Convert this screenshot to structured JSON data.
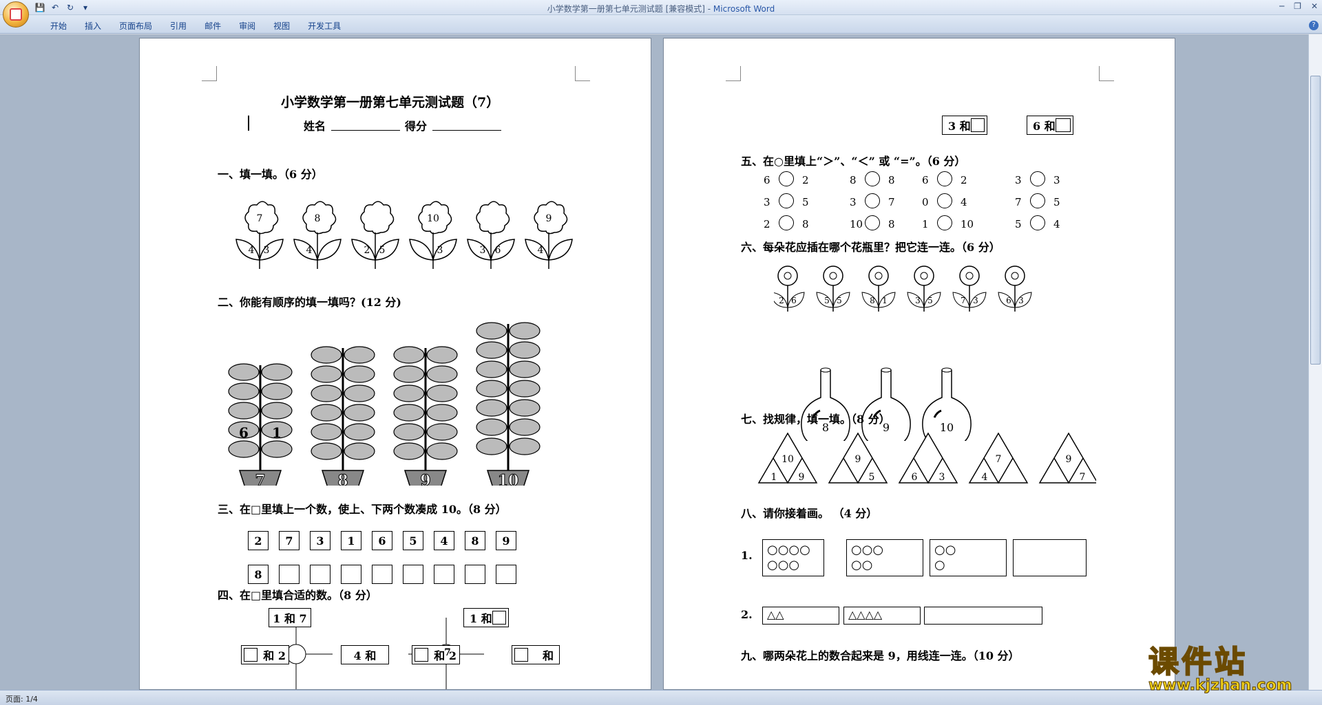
{
  "window": {
    "title": "小学数学第一册第七单元测试题 [兼容模式] - ",
    "app_name": "Microsoft Word"
  },
  "ribbon": {
    "tabs": [
      "开始",
      "插入",
      "页面布局",
      "引用",
      "邮件",
      "审阅",
      "视图",
      "开发工具"
    ]
  },
  "status": {
    "page": "页面: 1/4"
  },
  "watermark": {
    "text": "课件站",
    "url": "www.kjzhan.com"
  },
  "colors": {
    "watermark": "#f2d21a",
    "app_name": "#2a58a8"
  },
  "page1": {
    "title": "小学数学第一册第七单元测试题（7）",
    "name_label": "姓名",
    "score_label": "得分",
    "q1": "一、填一填。（6 分）",
    "flowers": [
      {
        "top": "7",
        "left": "4",
        "right": "3"
      },
      {
        "top": "8",
        "left": "4",
        "right": ""
      },
      {
        "top": "",
        "left": "2",
        "right": "5"
      },
      {
        "top": "10",
        "left": "",
        "right": "3"
      },
      {
        "top": "",
        "left": "3",
        "right": "6"
      },
      {
        "top": "9",
        "left": "4",
        "right": ""
      }
    ],
    "q2": "二、你能有顺序的填一填吗？(12 分)",
    "plants": [
      {
        "pot": "7",
        "left": "6",
        "right": "1"
      },
      {
        "pot": "8",
        "left": "",
        "right": ""
      },
      {
        "pot": "9",
        "left": "",
        "right": ""
      },
      {
        "pot": "10",
        "left": "",
        "right": ""
      }
    ],
    "q3": "三、在□里填上一个数，使上、下两个数凑成 10。（8 分）",
    "top_numbers": [
      "2",
      "7",
      "3",
      "1",
      "6",
      "5",
      "4",
      "8",
      "9"
    ],
    "bottom_numbers": [
      "8",
      "",
      "",
      "",
      "",
      "",
      "",
      "",
      ""
    ],
    "q4": "四、在□里填合适的数。（8 分）",
    "tree1": {
      "top": "1 和 7",
      "left": "和 2",
      "right": "4 和"
    },
    "tree2": {
      "top": "1 和",
      "left": "和 2",
      "center": "7",
      "right": "和"
    }
  },
  "page2": {
    "box_a": "3 和",
    "box_b": "6 和",
    "q5": "五、在○里填上“＞”、“＜” 或 “=”。（6 分）",
    "compare_rows": [
      [
        [
          "6",
          "2"
        ],
        [
          "8",
          "8"
        ],
        [
          "6",
          "2"
        ],
        [
          "3",
          "3"
        ]
      ],
      [
        [
          "3",
          "5"
        ],
        [
          "3",
          "7"
        ],
        [
          "0",
          "4"
        ],
        [
          "7",
          "5"
        ]
      ],
      [
        [
          "2",
          "8"
        ],
        [
          "10",
          "8"
        ],
        [
          "1",
          "10"
        ],
        [
          "5",
          "4"
        ]
      ]
    ],
    "q6": "六、每朵花应插在哪个花瓶里？把它连一连。（6 分）",
    "small_flowers": [
      [
        "2",
        "6"
      ],
      [
        "5",
        "5"
      ],
      [
        "8",
        "1"
      ],
      [
        "3",
        "5"
      ],
      [
        "7",
        "3"
      ],
      [
        "6",
        "3"
      ]
    ],
    "vases": [
      "8",
      "9",
      "10"
    ],
    "q7": "七、找规律，填一填。（8 分）",
    "triangles": [
      {
        "top": "10",
        "left": "1",
        "right": "9"
      },
      {
        "top": "9",
        "left": "",
        "right": "5"
      },
      {
        "top": "",
        "left": "6",
        "right": "3"
      },
      {
        "top": "7",
        "left": "4",
        "right": ""
      },
      {
        "top": "9",
        "left": "",
        "right": "7"
      }
    ],
    "q8": "八、请你接着画。 （4 分）",
    "row1_label": "1.",
    "circles_groups": [
      "○○○○\n○○○",
      "○○○\n○○",
      "○○\n○",
      ""
    ],
    "row2_label": "2.",
    "triangle_groups": [
      "△△",
      "△△△△",
      ""
    ],
    "q9": "九、哪两朵花上的数合起来是 9，用线连一连。（10 分）"
  }
}
